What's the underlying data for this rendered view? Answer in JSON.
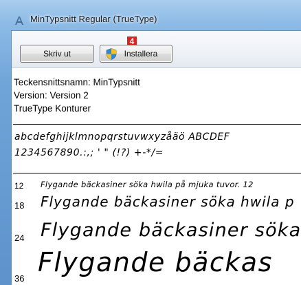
{
  "window": {
    "title": "MinTypsnitt Regular (TrueType)",
    "icon": "font-icon"
  },
  "toolbar": {
    "print_label": "Skriv ut",
    "install_label": "Installera",
    "install_icon": "uac-shield-icon",
    "callout_badge": "4",
    "callout_color": "#d9231f"
  },
  "font_info": {
    "name_line": "Teckensnittsnamn: MinTypsnitt",
    "version_line": "Version: Version 2",
    "type_line": "TrueType Konturer"
  },
  "charset": {
    "line1": "abcdefghijklmnopqrstuvwxyzåäö ABCDEF",
    "line2": "1234567890.:,; ' \" (!?) +-*/="
  },
  "samples": [
    {
      "size": "12",
      "text": "Flygande bäckasiner söka hwila på mjuka tuvor. 12"
    },
    {
      "size": "18",
      "text": "Flygande bäckasiner söka hwila p"
    },
    {
      "size": "24",
      "text": "Flygande bäckasiner söka"
    },
    {
      "size": "36",
      "text": "Flygande bäckas"
    }
  ]
}
